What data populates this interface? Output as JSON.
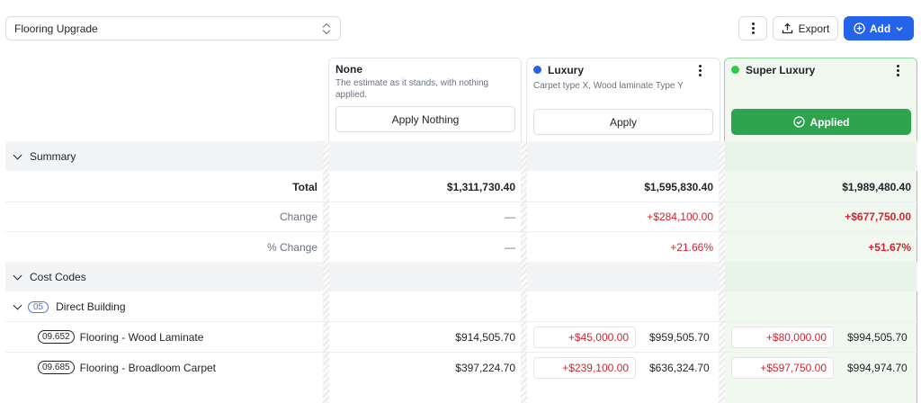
{
  "scenario_select": {
    "value": "Flooring Upgrade"
  },
  "toolbar": {
    "export_label": "Export",
    "add_label": "Add"
  },
  "columns": [
    {
      "title": "None",
      "description": "The estimate as it stands, with nothing applied.",
      "button_label": "Apply Nothing"
    },
    {
      "title": "Luxury",
      "description": "Carpet type X, Wood laminate Type Y",
      "button_label": "Apply",
      "dot_color": "#2563eb"
    },
    {
      "title": "Super Luxury",
      "description": "",
      "button_label": "Applied",
      "dot_color": "#2ecc40"
    }
  ],
  "summary": {
    "label": "Summary",
    "rows": [
      {
        "label": "Total",
        "values": [
          "$1,311,730.40",
          "$1,595,830.40",
          "$1,989,480.40"
        ]
      },
      {
        "label": "Change",
        "values": [
          "—",
          "+$284,100.00",
          "+$677,750.00"
        ]
      },
      {
        "label": "% Change",
        "values": [
          "—",
          "+21.66%",
          "+51.67%"
        ]
      }
    ]
  },
  "cost_codes": {
    "label": "Cost Codes",
    "group": {
      "code": "05",
      "label": "Direct Building"
    },
    "items": [
      {
        "code": "09.652",
        "label": "Flooring - Wood Laminate",
        "base": "$914,505.70",
        "lux_delta": "+$45,000.00",
        "lux_total": "$959,505.70",
        "super_delta": "+$80,000.00",
        "super_total": "$994,505.70"
      },
      {
        "code": "09.685",
        "label": "Flooring - Broadloom Carpet",
        "base": "$397,224.70",
        "lux_delta": "+$239,100.00",
        "lux_total": "$636,324.70",
        "super_delta": "+$597,750.00",
        "super_total": "$994,974.70"
      }
    ]
  },
  "colors": {
    "accent": "#2563eb",
    "applied": "#2ea44f",
    "negative": "#d1242f"
  }
}
